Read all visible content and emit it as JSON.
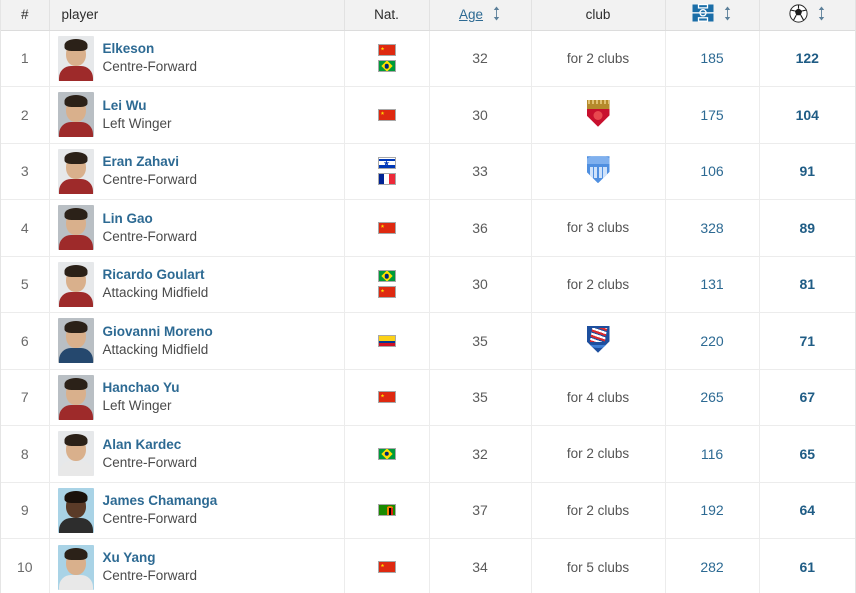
{
  "table": {
    "columns": [
      {
        "key": "rank",
        "label": "#",
        "icon": null
      },
      {
        "key": "player",
        "label": "player",
        "icon": null
      },
      {
        "key": "nat",
        "label": "Nat.",
        "icon": null
      },
      {
        "key": "age",
        "label": "Age",
        "icon": "sort-arrows-icon",
        "sortable": true
      },
      {
        "key": "club",
        "label": "club",
        "icon": null
      },
      {
        "key": "apps",
        "label": "",
        "icon": "pitch-icon",
        "sortable": true
      },
      {
        "key": "goals",
        "label": "",
        "icon": "football-icon",
        "sortable": true
      }
    ],
    "rows": [
      {
        "rank": "1",
        "name": "Elkeson",
        "position": "Centre-Forward",
        "nations": [
          "cn",
          "br"
        ],
        "age": "32",
        "club_text": "for 2 clubs",
        "club_logo": null,
        "apps": "185",
        "goals": "122",
        "photo": {
          "bg": "bg-light",
          "skin": "",
          "shirt": ""
        }
      },
      {
        "rank": "2",
        "name": "Lei Wu",
        "position": "Left Winger",
        "nations": [
          "cn"
        ],
        "age": "30",
        "club_text": "",
        "club_logo": "port",
        "apps": "175",
        "goals": "104",
        "photo": {
          "bg": "bg-grey",
          "skin": "",
          "shirt": ""
        }
      },
      {
        "rank": "3",
        "name": "Eran Zahavi",
        "position": "Centre-Forward",
        "nations": [
          "il",
          "fr"
        ],
        "age": "33",
        "club_text": "",
        "club_logo": "guoan",
        "apps": "106",
        "goals": "91",
        "photo": {
          "bg": "bg-light",
          "skin": "",
          "shirt": ""
        }
      },
      {
        "rank": "4",
        "name": "Lin Gao",
        "position": "Centre-Forward",
        "nations": [
          "cn"
        ],
        "age": "36",
        "club_text": "for 3 clubs",
        "club_logo": null,
        "apps": "328",
        "goals": "89",
        "photo": {
          "bg": "bg-grey",
          "skin": "",
          "shirt": ""
        }
      },
      {
        "rank": "5",
        "name": "Ricardo Goulart",
        "position": "Attacking Midfield",
        "nations": [
          "br",
          "cn"
        ],
        "age": "30",
        "club_text": "for 2 clubs",
        "club_logo": null,
        "apps": "131",
        "goals": "81",
        "photo": {
          "bg": "bg-light",
          "skin": "",
          "shirt": ""
        }
      },
      {
        "rank": "6",
        "name": "Giovanni Moreno",
        "position": "Attacking Midfield",
        "nations": [
          "co"
        ],
        "age": "35",
        "club_text": "",
        "club_logo": "shenhua",
        "apps": "220",
        "goals": "71",
        "photo": {
          "bg": "bg-grey",
          "skin": "",
          "shirt": "shirt-blue"
        }
      },
      {
        "rank": "7",
        "name": "Hanchao Yu",
        "position": "Left Winger",
        "nations": [
          "cn"
        ],
        "age": "35",
        "club_text": "for 4 clubs",
        "club_logo": null,
        "apps": "265",
        "goals": "67",
        "photo": {
          "bg": "bg-grey",
          "skin": "",
          "shirt": ""
        }
      },
      {
        "rank": "8",
        "name": "Alan Kardec",
        "position": "Centre-Forward",
        "nations": [
          "br"
        ],
        "age": "32",
        "club_text": "for 2 clubs",
        "club_logo": null,
        "apps": "116",
        "goals": "65",
        "photo": {
          "bg": "bg-light",
          "skin": "",
          "shirt": "shirt-white"
        }
      },
      {
        "rank": "9",
        "name": "James Chamanga",
        "position": "Centre-Forward",
        "nations": [
          "zm"
        ],
        "age": "37",
        "club_text": "for 2 clubs",
        "club_logo": null,
        "apps": "192",
        "goals": "64",
        "photo": {
          "bg": "bg-blue",
          "skin": "skin-dark",
          "shirt": "shirt-dark"
        }
      },
      {
        "rank": "10",
        "name": "Xu Yang",
        "position": "Centre-Forward",
        "nations": [
          "cn"
        ],
        "age": "34",
        "club_text": "for 5 clubs",
        "club_logo": null,
        "apps": "282",
        "goals": "61",
        "photo": {
          "bg": "bg-blue",
          "skin": "",
          "shirt": "shirt-white"
        }
      }
    ]
  },
  "colors": {
    "link": "#2d6a93",
    "goals": "#1f5c85",
    "header_bg": "#f2f2f2",
    "row_border": "#ececec"
  }
}
